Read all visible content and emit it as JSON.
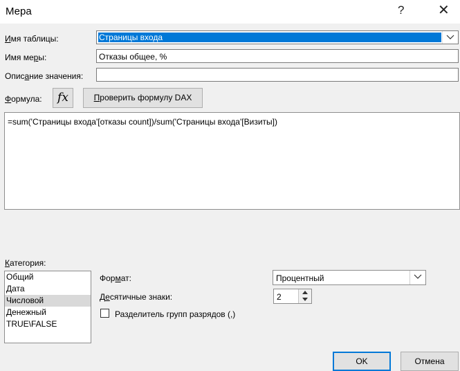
{
  "window": {
    "title": "Мера",
    "help_glyph": "?",
    "close_glyph": "✕"
  },
  "fields": {
    "table_label_pre": "И",
    "table_label_rest": "мя таблицы:",
    "table_value": "Страницы входа",
    "measure_label_pre": "Имя ме",
    "measure_label_u": "р",
    "measure_label_post": "ы:",
    "measure_value": "Отказы общее, %",
    "desc_label_pre": "Опис",
    "desc_label_u": "а",
    "desc_label_post": "ние значения:",
    "desc_value": ""
  },
  "formula": {
    "label_u": "Ф",
    "label_rest": "ормула:",
    "fx_label": "fx",
    "check_label_u": "П",
    "check_label_rest": "роверить формулу DAX",
    "text": "=sum('Страницы входа'[отказы count])/sum('Страницы входа'[Визиты])"
  },
  "category": {
    "label_u": "К",
    "label_rest": "атегория:",
    "items": [
      {
        "label": "Общий",
        "selected": false
      },
      {
        "label": "Дата",
        "selected": false
      },
      {
        "label": "Числовой",
        "selected": true
      },
      {
        "label": "Денежный",
        "selected": false
      },
      {
        "label": "TRUE\\FALSE",
        "selected": false
      }
    ]
  },
  "format": {
    "label_pre": "Фор",
    "label_u": "м",
    "label_post": "ат:",
    "value": "Процентный",
    "decimals_label_pre": "Д",
    "decimals_label_u": "е",
    "decimals_label_post": "сятичные знаки:",
    "decimals_value": "2",
    "thousands_label": "Разделитель групп разрядов (,)",
    "thousands_checked": false
  },
  "buttons": {
    "ok": "OK",
    "cancel": "Отмена"
  },
  "colors": {
    "selection": "#0078d7",
    "dialog_bg": "#f0f0f0"
  }
}
